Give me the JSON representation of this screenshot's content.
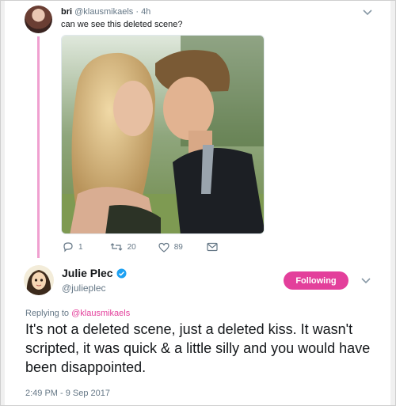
{
  "reply_to_tweet": {
    "display_name": "bri",
    "handle": "@klausmikaels",
    "separator": "·",
    "age": "4h",
    "text": "can we see this deleted scene?",
    "actions": {
      "replies": "1",
      "retweets": "20",
      "likes": "89"
    }
  },
  "main_tweet": {
    "display_name": "Julie Plec",
    "handle": "@julieplec",
    "follow_label": "Following",
    "replying_prefix": "Replying to",
    "replying_to": "@klausmikaels",
    "text": "It's not a deleted scene, just a deleted kiss. It wasn't scripted, it was quick & a little silly and you would have been disappointed.",
    "timestamp": "2:49 PM - 9 Sep 2017"
  },
  "colors": {
    "accent": "#e33f9b",
    "thread_line": "#f0a0d0",
    "muted_text": "#657786"
  },
  "icons": [
    "chevron-down-icon",
    "reply-icon",
    "retweet-icon",
    "like-icon",
    "direct-message-icon",
    "verified-badge-icon"
  ]
}
